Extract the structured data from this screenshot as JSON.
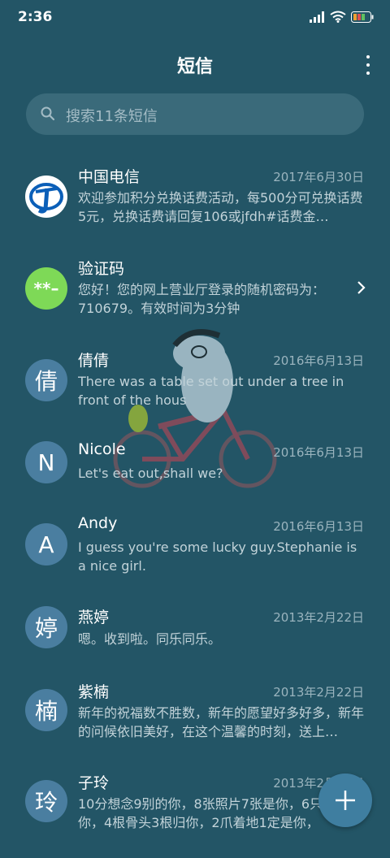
{
  "status_bar": {
    "time": "2:36"
  },
  "header": {
    "title": "短信"
  },
  "search": {
    "placeholder": "搜索11条短信"
  },
  "conversations": [
    {
      "name": "中国电信",
      "date": "2017年6月30日",
      "preview": "欢迎参加积分兑换话费活动，每500分可兑换话费5元，兑换话费请回复106或jfdh#话费金…",
      "avatar_icon": "china-telecom-logo"
    },
    {
      "name": "验证码",
      "date": "",
      "preview": "您好！您的网上营业厅登录的随机密码为：710679。有效时间为3分钟",
      "avatar_text": "**–"
    },
    {
      "name": "倩倩",
      "date": "2016年6月13日",
      "preview": "There was a table set out under a tree in front of the hous",
      "avatar_text": "倩"
    },
    {
      "name": "Nicole",
      "date": "2016年6月13日",
      "preview": "Let's eat out,shall we?",
      "avatar_text": "N"
    },
    {
      "name": "Andy",
      "date": "2016年6月13日",
      "preview": "I guess you're some lucky guy.Stephanie is a nice girl.",
      "avatar_text": "A"
    },
    {
      "name": "燕婷",
      "date": "2013年2月22日",
      "preview": "嗯。收到啦。同乐同乐。",
      "avatar_text": "婷"
    },
    {
      "name": "紫楠",
      "date": "2013年2月22日",
      "preview": "新年的祝福数不胜数，新年的愿望好多好多，新年的问候依旧美好，在这个温馨的时刻，送上…",
      "avatar_text": "楠"
    },
    {
      "name": "子玲",
      "date": "2013年2月22日",
      "preview": "10分想念9别的你，8张照片7张是你，6只…只像你，4根骨头3根归你，2爪着地1定是你，",
      "avatar_text": "玲"
    }
  ],
  "colors": {
    "background": "#235566",
    "search_bg": "#3a6a7a",
    "avatar": "#4a7ea0",
    "verify_avatar": "#7ed957",
    "fab": "#3f7ea0"
  }
}
